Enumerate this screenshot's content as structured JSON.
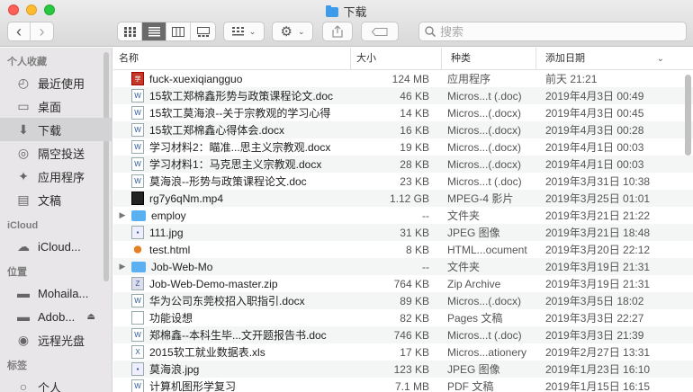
{
  "window": {
    "title": "下载"
  },
  "toolbar": {
    "back": "‹",
    "forward": "›",
    "search_placeholder": "搜索"
  },
  "sidebar": {
    "favorites_header": "个人收藏",
    "favorites": [
      {
        "label": "最近使用",
        "icon": "clock-icon"
      },
      {
        "label": "桌面",
        "icon": "desktop-icon"
      },
      {
        "label": "下载",
        "icon": "download-icon",
        "selected": true
      },
      {
        "label": "隔空投送",
        "icon": "airdrop-icon"
      },
      {
        "label": "应用程序",
        "icon": "applications-icon"
      },
      {
        "label": "文稿",
        "icon": "document-icon"
      }
    ],
    "icloud_header": "iCloud",
    "icloud": [
      {
        "label": "iCloud...",
        "icon": "cloud-icon"
      }
    ],
    "locations_header": "位置",
    "locations": [
      {
        "label": "Mohaila...",
        "icon": "disk-icon"
      },
      {
        "label": "Adob...",
        "icon": "disk-icon",
        "eject": true
      },
      {
        "label": "远程光盘",
        "icon": "disc-icon"
      }
    ],
    "tags_header": "标签",
    "tags": [
      {
        "label": "个人",
        "icon": "tag-icon"
      }
    ]
  },
  "columns": {
    "name": "名称",
    "size": "大小",
    "kind": "种类",
    "date": "添加日期"
  },
  "files": [
    {
      "name": "fuck-xuexiqiangguo",
      "size": "124 MB",
      "kind": "应用程序",
      "date": "前天 21:21",
      "icon": "app"
    },
    {
      "name": "15软工郑棉鑫形势与政策课程论文.doc",
      "size": "46 KB",
      "kind": "Micros...t (.doc)",
      "date": "2019年4月3日 00:49",
      "icon": "doc"
    },
    {
      "name": "15软工莫海浪--关于宗教观的学习心得",
      "size": "14 KB",
      "kind": "Micros...(.docx)",
      "date": "2019年4月3日 00:45",
      "icon": "doc"
    },
    {
      "name": "15软工郑棉鑫心得体会.docx",
      "size": "16 KB",
      "kind": "Micros...(.docx)",
      "date": "2019年4月3日 00:28",
      "icon": "doc"
    },
    {
      "name": "学习材料2：瞄准...思主义宗教观.docx",
      "size": "19 KB",
      "kind": "Micros...(.docx)",
      "date": "2019年4月1日 00:03",
      "icon": "doc"
    },
    {
      "name": "学习材料1：马克思主义宗教观.docx",
      "size": "28 KB",
      "kind": "Micros...(.docx)",
      "date": "2019年4月1日 00:03",
      "icon": "doc"
    },
    {
      "name": "莫海浪--形势与政策课程论文.doc",
      "size": "23 KB",
      "kind": "Micros...t (.doc)",
      "date": "2019年3月31日 10:38",
      "icon": "doc"
    },
    {
      "name": "rg7y6qNm.mp4",
      "size": "1.12 GB",
      "kind": "MPEG-4 影片",
      "date": "2019年3月25日 01:01",
      "icon": "video"
    },
    {
      "name": "employ",
      "size": "--",
      "kind": "文件夹",
      "date": "2019年3月21日 21:22",
      "icon": "folder",
      "expandable": true
    },
    {
      "name": "111.jpg",
      "size": "31 KB",
      "kind": "JPEG 图像",
      "date": "2019年3月21日 18:48",
      "icon": "img"
    },
    {
      "name": "test.html",
      "size": "8 KB",
      "kind": "HTML...ocument",
      "date": "2019年3月20日 22:12",
      "icon": "html"
    },
    {
      "name": "Job-Web-Mo",
      "size": "--",
      "kind": "文件夹",
      "date": "2019年3月19日 21:31",
      "icon": "folder",
      "expandable": true
    },
    {
      "name": "Job-Web-Demo-master.zip",
      "size": "764 KB",
      "kind": "Zip Archive",
      "date": "2019年3月19日 21:31",
      "icon": "zip"
    },
    {
      "name": "华为公司东莞校招入职指引.docx",
      "size": "89 KB",
      "kind": "Micros...(.docx)",
      "date": "2019年3月5日 18:02",
      "icon": "doc"
    },
    {
      "name": "功能设想",
      "size": "82 KB",
      "kind": "Pages 文稿",
      "date": "2019年3月3日 22:27",
      "icon": "blank"
    },
    {
      "name": "郑棉鑫--本科生毕...文开题报告书.doc",
      "size": "746 KB",
      "kind": "Micros...t (.doc)",
      "date": "2019年3月3日 21:39",
      "icon": "doc"
    },
    {
      "name": "2015软工就业数据表.xls",
      "size": "17 KB",
      "kind": "Micros...ationery",
      "date": "2019年2月27日 13:31",
      "icon": "xls"
    },
    {
      "name": "莫海浪.jpg",
      "size": "123 KB",
      "kind": "JPEG 图像",
      "date": "2019年1月23日 16:10",
      "icon": "img"
    },
    {
      "name": "计算机图形学复习",
      "size": "7.1 MB",
      "kind": "PDF 文稿",
      "date": "2019年1月15日 16:15",
      "icon": "doc"
    }
  ]
}
